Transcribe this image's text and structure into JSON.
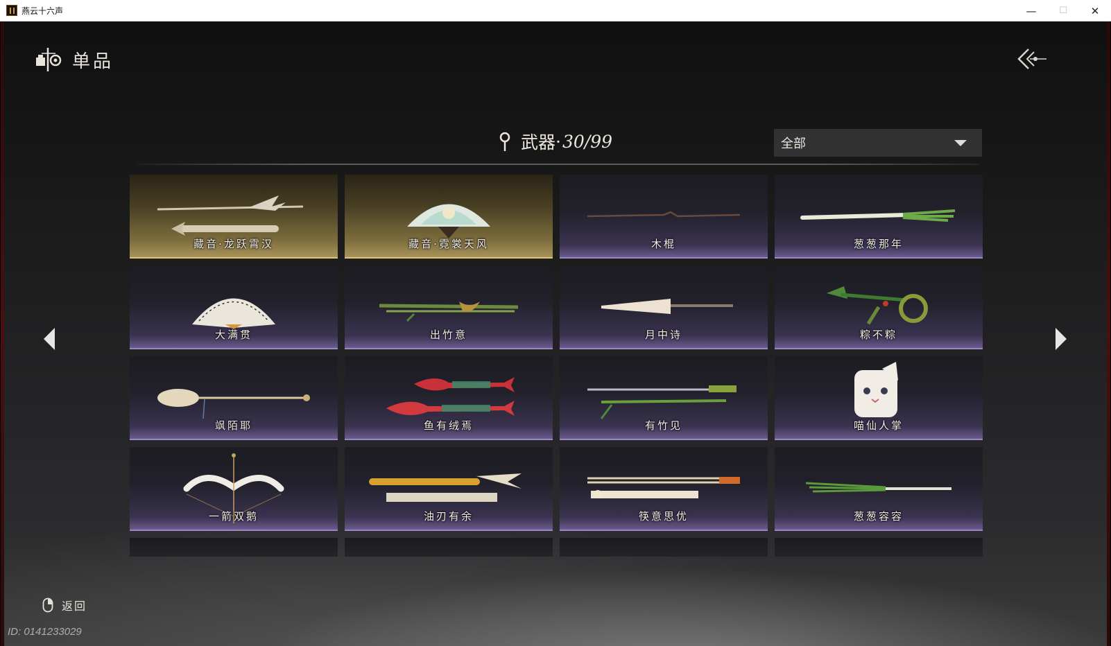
{
  "window": {
    "title": "燕云十六声",
    "minimize": "—",
    "maximize": "☐",
    "close": "✕"
  },
  "header": {
    "title": "单品",
    "icon": "wardrobe-item-icon",
    "back_icon": "back-arrow-icon"
  },
  "category": {
    "name": "武器",
    "separator": "·",
    "count": "30/99",
    "icon": "pin-icon"
  },
  "filter": {
    "selected": "全部",
    "icon": "chevron-down-icon"
  },
  "items": [
    {
      "name": "藏音·龙跃霄汉",
      "rarity": "gold"
    },
    {
      "name": "藏音·霓裳天风",
      "rarity": "gold"
    },
    {
      "name": "木棍",
      "rarity": "purple"
    },
    {
      "name": "葱葱那年",
      "rarity": "purple"
    },
    {
      "name": "大满贯",
      "rarity": "purple"
    },
    {
      "name": "出竹意",
      "rarity": "purple"
    },
    {
      "name": "月中诗",
      "rarity": "purple"
    },
    {
      "name": "粽不粽",
      "rarity": "purple"
    },
    {
      "name": "飒陌耶",
      "rarity": "purple"
    },
    {
      "name": "鱼有绒焉",
      "rarity": "purple"
    },
    {
      "name": "有竹见",
      "rarity": "purple"
    },
    {
      "name": "喵仙人掌",
      "rarity": "purple"
    },
    {
      "name": "一箭双鹅",
      "rarity": "purple"
    },
    {
      "name": "油刃有余",
      "rarity": "purple"
    },
    {
      "name": "筷意思优",
      "rarity": "purple"
    },
    {
      "name": "葱葱容容",
      "rarity": "purple"
    }
  ],
  "nav": {
    "prev_icon": "arrow-left-icon",
    "next_icon": "arrow-right-icon"
  },
  "footer": {
    "return_label": "返回",
    "return_icon": "mouse-right-click-icon",
    "player_id": "ID: 0141233029"
  },
  "colors": {
    "gold_card": "#7e6e3e",
    "purple_card": "#6b5a8d",
    "text": "#f2efe8"
  }
}
